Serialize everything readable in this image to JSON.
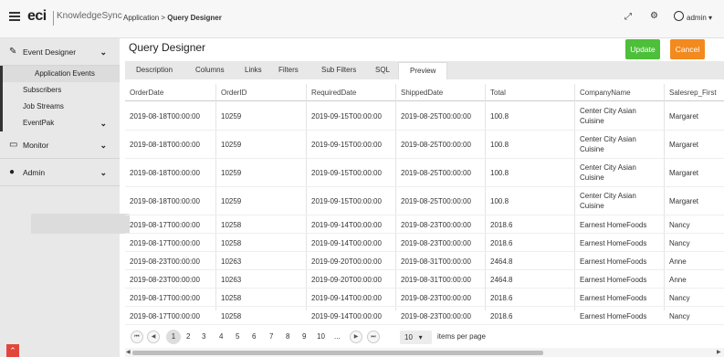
{
  "header": {
    "logo_main": "eci",
    "logo_product": "KnowledgeSync",
    "breadcrumb_parent": "Application > ",
    "breadcrumb_current": "Query Designer",
    "user": "admin"
  },
  "sidebar": {
    "groups": [
      {
        "label": "Event Designer",
        "icon": "edit-icon"
      },
      {
        "label": "Monitor",
        "icon": "monitor-icon"
      },
      {
        "label": "Admin",
        "icon": "user-icon"
      }
    ],
    "sub_items": [
      {
        "label": "Application Events",
        "active": true
      },
      {
        "label": "Subscribers"
      },
      {
        "label": "Job Streams"
      },
      {
        "label": "EventPak"
      }
    ]
  },
  "page": {
    "title": "Query Designer",
    "update_label": "Update",
    "cancel_label": "Cancel"
  },
  "tabs": [
    "Description",
    "Columns",
    "Links",
    "Filters",
    "Sub Filters",
    "SQL",
    "Preview"
  ],
  "table": {
    "columns": [
      "OrderDate",
      "OrderID",
      "RequiredDate",
      "ShippedDate",
      "Total",
      "CompanyName",
      "Salesrep_First"
    ],
    "rows": [
      [
        "2019-08-18T00:00:00",
        "10259",
        "2019-09-15T00:00:00",
        "2019-08-25T00:00:00",
        "100.8",
        "Center City Asian Cuisine",
        "Margaret"
      ],
      [
        "2019-08-18T00:00:00",
        "10259",
        "2019-09-15T00:00:00",
        "2019-08-25T00:00:00",
        "100.8",
        "Center City Asian Cuisine",
        "Margaret"
      ],
      [
        "2019-08-18T00:00:00",
        "10259",
        "2019-09-15T00:00:00",
        "2019-08-25T00:00:00",
        "100.8",
        "Center City Asian Cuisine",
        "Margaret"
      ],
      [
        "2019-08-18T00:00:00",
        "10259",
        "2019-09-15T00:00:00",
        "2019-08-25T00:00:00",
        "100.8",
        "Center City Asian Cuisine",
        "Margaret"
      ],
      [
        "2019-08-17T00:00:00",
        "10258",
        "2019-09-14T00:00:00",
        "2019-08-23T00:00:00",
        "2018.6",
        "Earnest HomeFoods",
        "Nancy"
      ],
      [
        "2019-08-17T00:00:00",
        "10258",
        "2019-09-14T00:00:00",
        "2019-08-23T00:00:00",
        "2018.6",
        "Earnest HomeFoods",
        "Nancy"
      ],
      [
        "2019-08-23T00:00:00",
        "10263",
        "2019-09-20T00:00:00",
        "2019-08-31T00:00:00",
        "2464.8",
        "Earnest HomeFoods",
        "Anne"
      ],
      [
        "2019-08-23T00:00:00",
        "10263",
        "2019-09-20T00:00:00",
        "2019-08-31T00:00:00",
        "2464.8",
        "Earnest HomeFoods",
        "Anne"
      ],
      [
        "2019-08-17T00:00:00",
        "10258",
        "2019-09-14T00:00:00",
        "2019-08-23T00:00:00",
        "2018.6",
        "Earnest HomeFoods",
        "Nancy"
      ],
      [
        "2019-08-17T00:00:00",
        "10258",
        "2019-09-14T00:00:00",
        "2019-08-23T00:00:00",
        "2018.6",
        "Earnest HomeFoods",
        "Nancy"
      ]
    ]
  },
  "pager": {
    "pages": [
      "1",
      "2",
      "3",
      "4",
      "5",
      "6",
      "7",
      "8",
      "9",
      "10",
      "..."
    ],
    "current_page": "1",
    "page_size": "10",
    "items_per_page_label": "items per page"
  }
}
